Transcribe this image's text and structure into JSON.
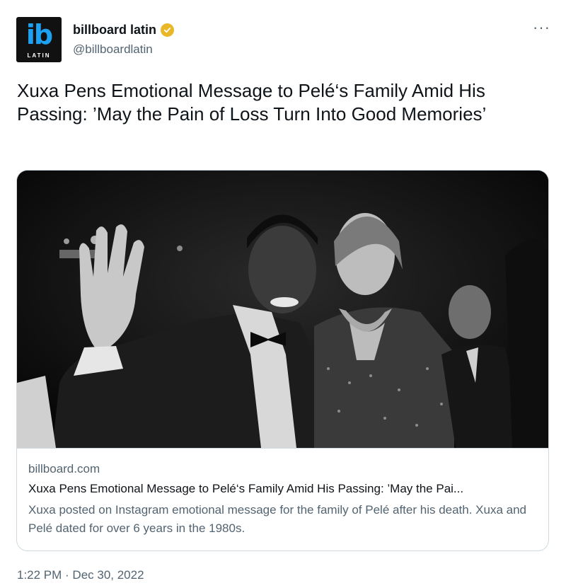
{
  "account": {
    "avatar_mark": "ib",
    "avatar_sub": "LATIN",
    "name": "billboard latin",
    "handle": "@billboardlatin",
    "verified_color": "#e8b829",
    "verified_icon": "verified-badge-icon"
  },
  "menu": {
    "more_label": "···",
    "more_icon": "more-options-icon"
  },
  "tweet": {
    "text": "Xuxa Pens Emotional Message to Pelé‘s Family Amid His Passing: ’May the Pain of Loss Turn Into Good Memories’",
    "timestamp": "1:22 PM · Dec 30, 2022"
  },
  "card": {
    "image_icon": "photo-icon",
    "domain": "billboard.com",
    "title": "Xuxa Pens Emotional Message to Pelé‘s Family Amid His Passing: ’May the Pai...",
    "description": "Xuxa posted on Instagram emotional message for the family of Pelé after his death. Xuxa and Pelé dated for over 6 years in the 1980s."
  },
  "colors": {
    "text_primary": "#0f1419",
    "text_secondary": "#536471",
    "border": "#cfd9de",
    "brand_blue": "#1da1f2"
  }
}
